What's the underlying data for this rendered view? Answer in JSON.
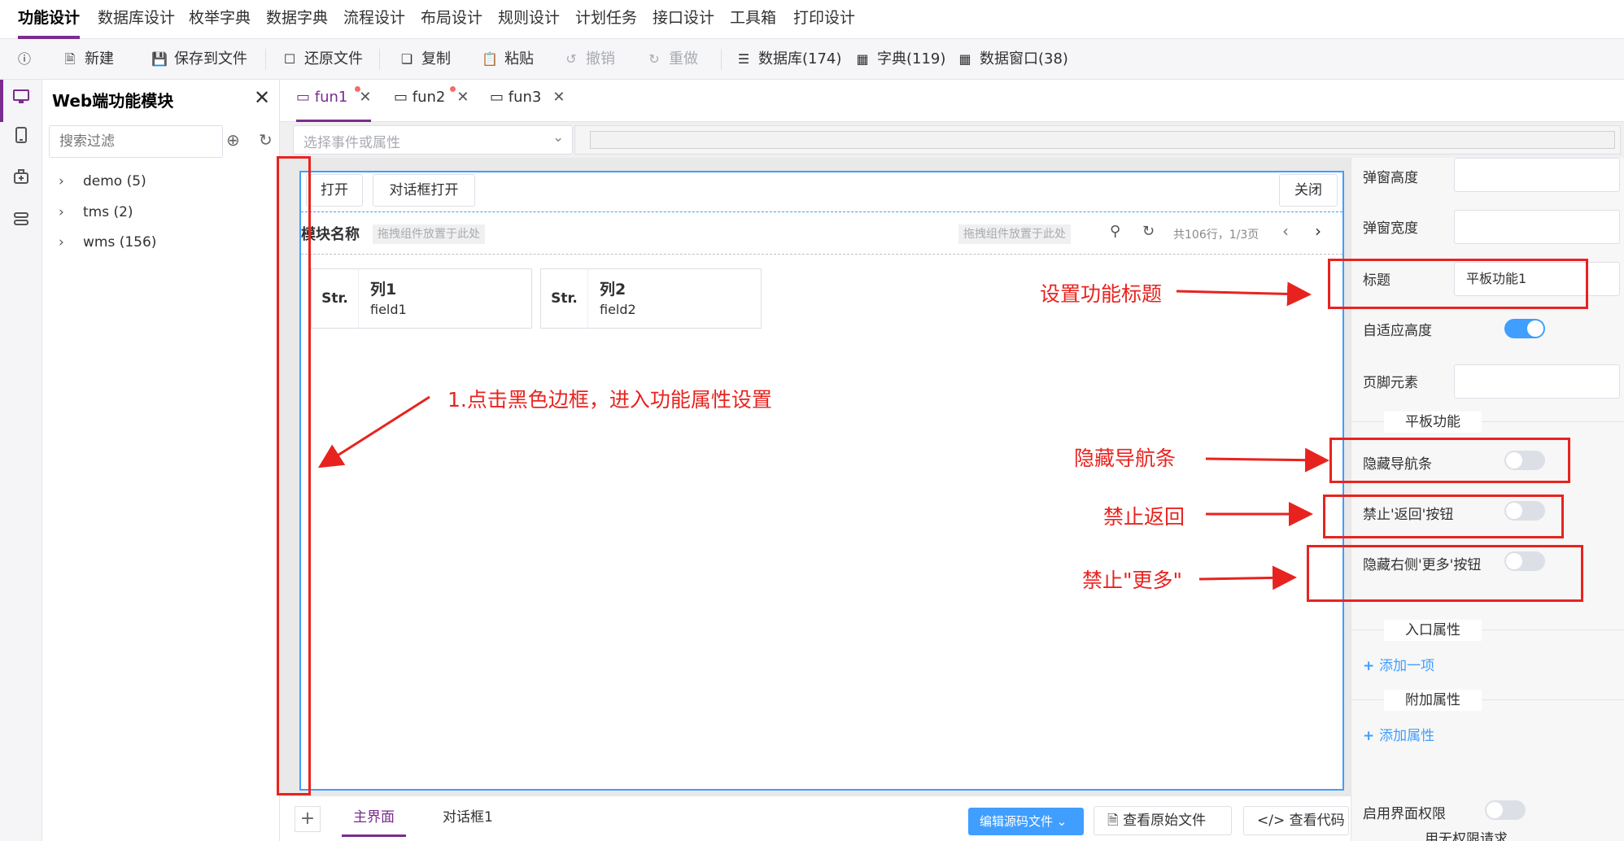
{
  "top_menu": [
    {
      "label": "功能设计",
      "active": true
    },
    {
      "label": "数据库设计"
    },
    {
      "label": "枚举字典"
    },
    {
      "label": "数据字典"
    },
    {
      "label": "流程设计"
    },
    {
      "label": "布局设计"
    },
    {
      "label": "规则设计"
    },
    {
      "label": "计划任务"
    },
    {
      "label": "接口设计"
    },
    {
      "label": "工具箱"
    },
    {
      "label": "打印设计"
    }
  ],
  "toolbar": {
    "info_icon": "info-icon",
    "new_label": "新建",
    "save_label": "保存到文件",
    "restore_label": "还原文件",
    "copy_label": "复制",
    "paste_label": "粘贴",
    "undo_label": "撤销",
    "redo_label": "重做",
    "database_label": "数据库(174)",
    "dict_label": "字典(119)",
    "data_window_label": "数据窗口(38)"
  },
  "activity_bar": [
    "desktop-icon",
    "tablet-icon",
    "module-icon",
    "settings-icon"
  ],
  "panel": {
    "title": "Web端功能模块",
    "filter_placeholder": "搜索过滤",
    "tree": [
      {
        "label": "demo (5)"
      },
      {
        "label": "tms (2)"
      },
      {
        "label": "wms (156)"
      }
    ]
  },
  "editor_tabs": [
    {
      "label": "fun1",
      "active": true,
      "modified": true
    },
    {
      "label": "fun2",
      "modified": true
    },
    {
      "label": "fun3"
    }
  ],
  "event_select_placeholder": "选择事件或属性",
  "designer": {
    "open_button": "打开",
    "dialog_open_button": "对话框打开",
    "close_button": "关闭",
    "module_name": "模块名称",
    "drop_placeholder_left": "拖拽组件放置于此处",
    "drop_placeholder_right": "拖拽组件放置于此处",
    "pagination": "共106行，1/3页",
    "fields": [
      {
        "type": "Str.",
        "title": "列1",
        "field": "field1"
      },
      {
        "type": "Str.",
        "title": "列2",
        "field": "field2"
      }
    ]
  },
  "properties": {
    "popup_height_label": "弹窗高度",
    "popup_width_label": "弹窗宽度",
    "title_label": "标题",
    "title_value": "平板功能1",
    "auto_height_label": "自适应高度",
    "auto_height_on": true,
    "footer_label": "页脚元素",
    "tablet_section": "平板功能",
    "hide_nav_label": "隐藏导航条",
    "disable_back_label": "禁止'返回'按钮",
    "hide_more_label": "隐藏右侧'更多'按钮",
    "entry_section": "入口属性",
    "add_item_link": "添加一项",
    "extra_section": "附加属性",
    "add_attr_link": "添加属性",
    "enable_perm_label": "启用界面权限",
    "cut_label": "用无权限请求"
  },
  "bottom_bar": {
    "add_icon": "plus-icon",
    "main_tab": "主界面",
    "dialog_tab": "对话框1",
    "edit_source_button": "编辑源码文件",
    "view_original_button": "查看原始文件",
    "view_code_button": "查看代码"
  },
  "annotations": {
    "step1": "1.点击黑色边框，进入功能属性设置",
    "set_title": "设置功能标题",
    "hide_nav": "隐藏导航条",
    "disable_back": "禁止返回",
    "disable_more": "禁止\"更多\"",
    "color": "#e8231f"
  }
}
